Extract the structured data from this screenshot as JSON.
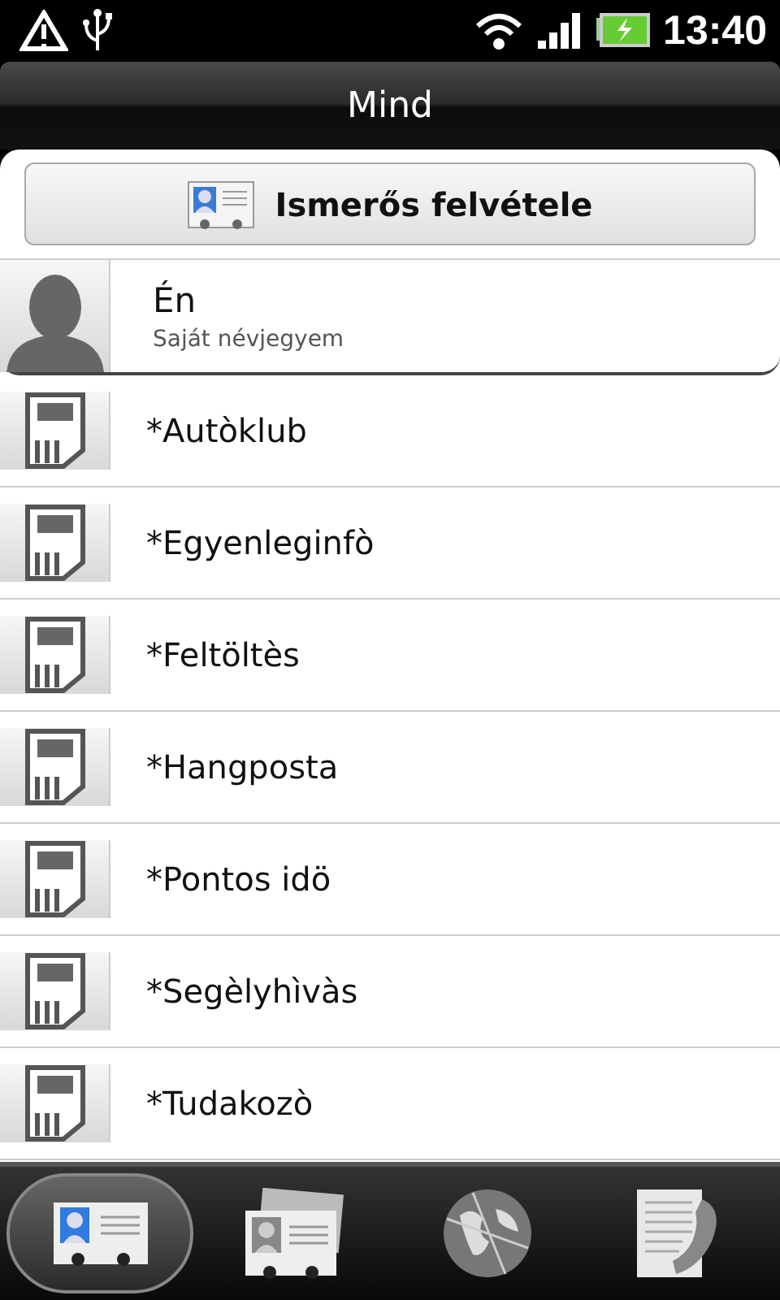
{
  "status_bar": {
    "time": "13:40"
  },
  "title": "Mind",
  "add_button": {
    "label": "Ismerős felvétele"
  },
  "me": {
    "name": "Én",
    "subtitle": "Saját névjegyem"
  },
  "contacts": [
    {
      "name": "*Autòklub"
    },
    {
      "name": "*Egyenleginfò"
    },
    {
      "name": "*Feltöltès"
    },
    {
      "name": "*Hangposta"
    },
    {
      "name": "*Pontos idö"
    },
    {
      "name": "*Segèlyhìvàs"
    },
    {
      "name": "*Tudakozò"
    }
  ],
  "tabs": [
    {
      "kind": "contact",
      "selected": true
    },
    {
      "kind": "groups",
      "selected": false
    },
    {
      "kind": "online",
      "selected": false
    },
    {
      "kind": "calls",
      "selected": false
    }
  ]
}
